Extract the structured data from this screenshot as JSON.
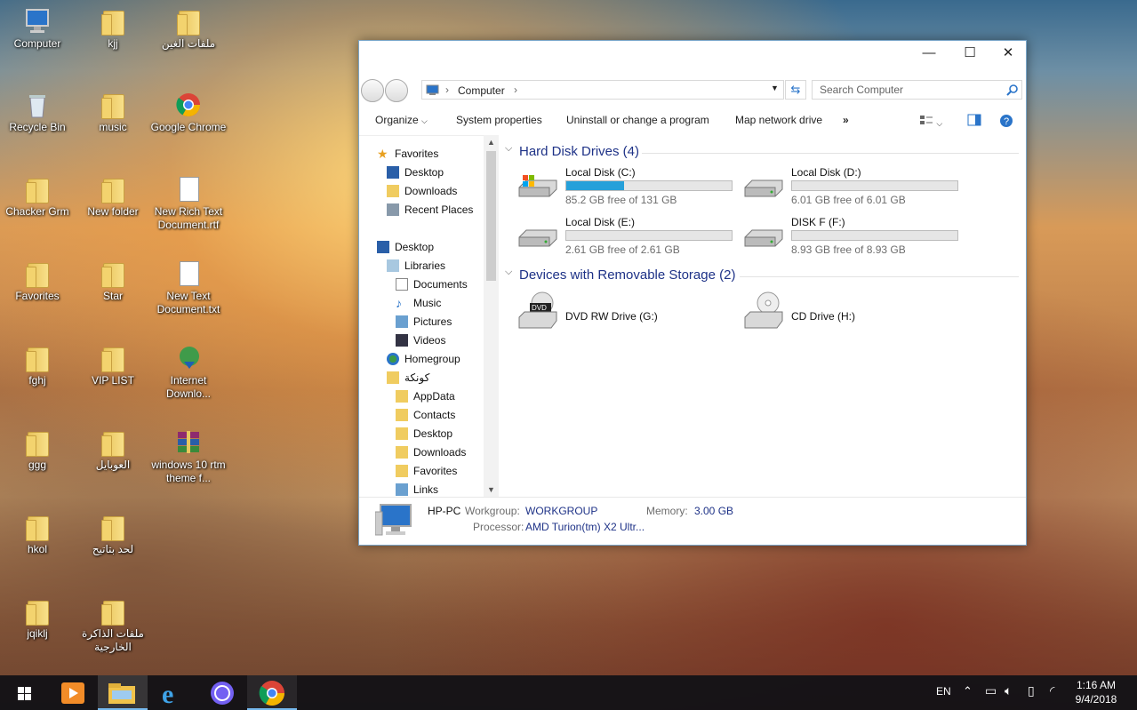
{
  "desktop": {
    "icons": [
      {
        "label": "Computer",
        "icon": "computer-icon"
      },
      {
        "label": "kjj",
        "icon": "folder-icon"
      },
      {
        "label": "ملفات الغين",
        "icon": "folder-icon"
      },
      {
        "label": "Recycle Bin",
        "icon": "recycle-bin-icon"
      },
      {
        "label": "music",
        "icon": "folder-icon"
      },
      {
        "label": "Google Chrome",
        "icon": "chrome-icon"
      },
      {
        "label": "Chacker Grm",
        "icon": "folder-icon"
      },
      {
        "label": "New folder",
        "icon": "folder-icon"
      },
      {
        "label": "New Rich Text Document.rtf",
        "icon": "document-icon"
      },
      {
        "label": "Favorites",
        "icon": "favorites-folder-icon"
      },
      {
        "label": "Star",
        "icon": "folder-icon"
      },
      {
        "label": "New Text Document.txt",
        "icon": "text-document-icon"
      },
      {
        "label": "fghj",
        "icon": "folder-icon"
      },
      {
        "label": "VIP LIST",
        "icon": "folder-icon"
      },
      {
        "label": "Internet Downlo...",
        "icon": "internet-download-icon"
      },
      {
        "label": "ggg",
        "icon": "folder-icon"
      },
      {
        "label": "العوبايل",
        "icon": "folder-icon"
      },
      {
        "label": "windows 10 rtm theme f...",
        "icon": "winrar-archive-icon"
      },
      {
        "label": "hkol",
        "icon": "folder-icon"
      },
      {
        "label": "لحد بتاتيح",
        "icon": "folder-icon"
      },
      {
        "label": "jqiklj",
        "icon": "folder-icon"
      },
      {
        "label": "ملفات الذاكرة الخارجية",
        "icon": "folder-icon"
      }
    ]
  },
  "window": {
    "controls": {
      "minimize": "—",
      "maximize": "☐",
      "close": "✕"
    },
    "address": {
      "segments": [
        "Computer"
      ]
    },
    "search": {
      "placeholder": "Search Computer"
    },
    "toolbar": {
      "organize": "Organize",
      "system_properties": "System properties",
      "uninstall": "Uninstall or change a program",
      "map_drive": "Map network drive",
      "more": "»"
    },
    "nav": {
      "favorites": {
        "label": "Favorites",
        "items": [
          "Desktop",
          "Downloads",
          "Recent Places"
        ]
      },
      "desktop": "Desktop",
      "libraries": {
        "label": "Libraries",
        "items": [
          "Documents",
          "Music",
          "Pictures",
          "Videos"
        ]
      },
      "homegroup": "Homegroup",
      "user": {
        "label": "كونكة",
        "items": [
          "AppData",
          "Contacts",
          "Desktop",
          "Downloads",
          "Favorites",
          "Links"
        ]
      }
    },
    "groups": {
      "hdd": {
        "title": "Hard Disk Drives (4)"
      },
      "removable": {
        "title": "Devices with Removable Storage (2)"
      }
    },
    "drives": [
      {
        "name": "Local Disk (C:)",
        "free": "85.2 GB free of 131 GB",
        "used_fraction": 0.35,
        "icon": "windows-drive-icon"
      },
      {
        "name": "Local Disk (D:)",
        "free": "6.01 GB free of 6.01 GB",
        "used_fraction": 0.0,
        "icon": "hard-drive-icon"
      },
      {
        "name": "Local Disk (E:)",
        "free": "2.61 GB free of 2.61 GB",
        "used_fraction": 0.0,
        "icon": "hard-drive-icon"
      },
      {
        "name": "DISK F (F:)",
        "free": "8.93 GB free of 8.93 GB",
        "used_fraction": 0.0,
        "icon": "hard-drive-icon"
      }
    ],
    "removable": [
      {
        "name": "DVD RW Drive (G:)",
        "icon": "dvd-drive-icon",
        "badge": "DVD"
      },
      {
        "name": "CD Drive (H:)",
        "icon": "cd-drive-icon"
      }
    ],
    "details": {
      "pc_name": "HP-PC",
      "workgroup_label": "Workgroup:",
      "workgroup": "WORKGROUP",
      "memory_label": "Memory:",
      "memory": "3.00 GB",
      "processor_label": "Processor:",
      "processor": "AMD Turion(tm) X2 Ultr..."
    }
  },
  "taskbar": {
    "apps": [
      "media-player-icon",
      "file-explorer-icon",
      "internet-explorer-icon",
      "viber-icon",
      "chrome-icon"
    ],
    "tray": {
      "lang": "EN",
      "time": "1:16 AM",
      "date": "9/4/2018"
    }
  },
  "colors": {
    "accent": "#26a0da",
    "group_header": "#1e3287",
    "taskbar": "#121216"
  }
}
